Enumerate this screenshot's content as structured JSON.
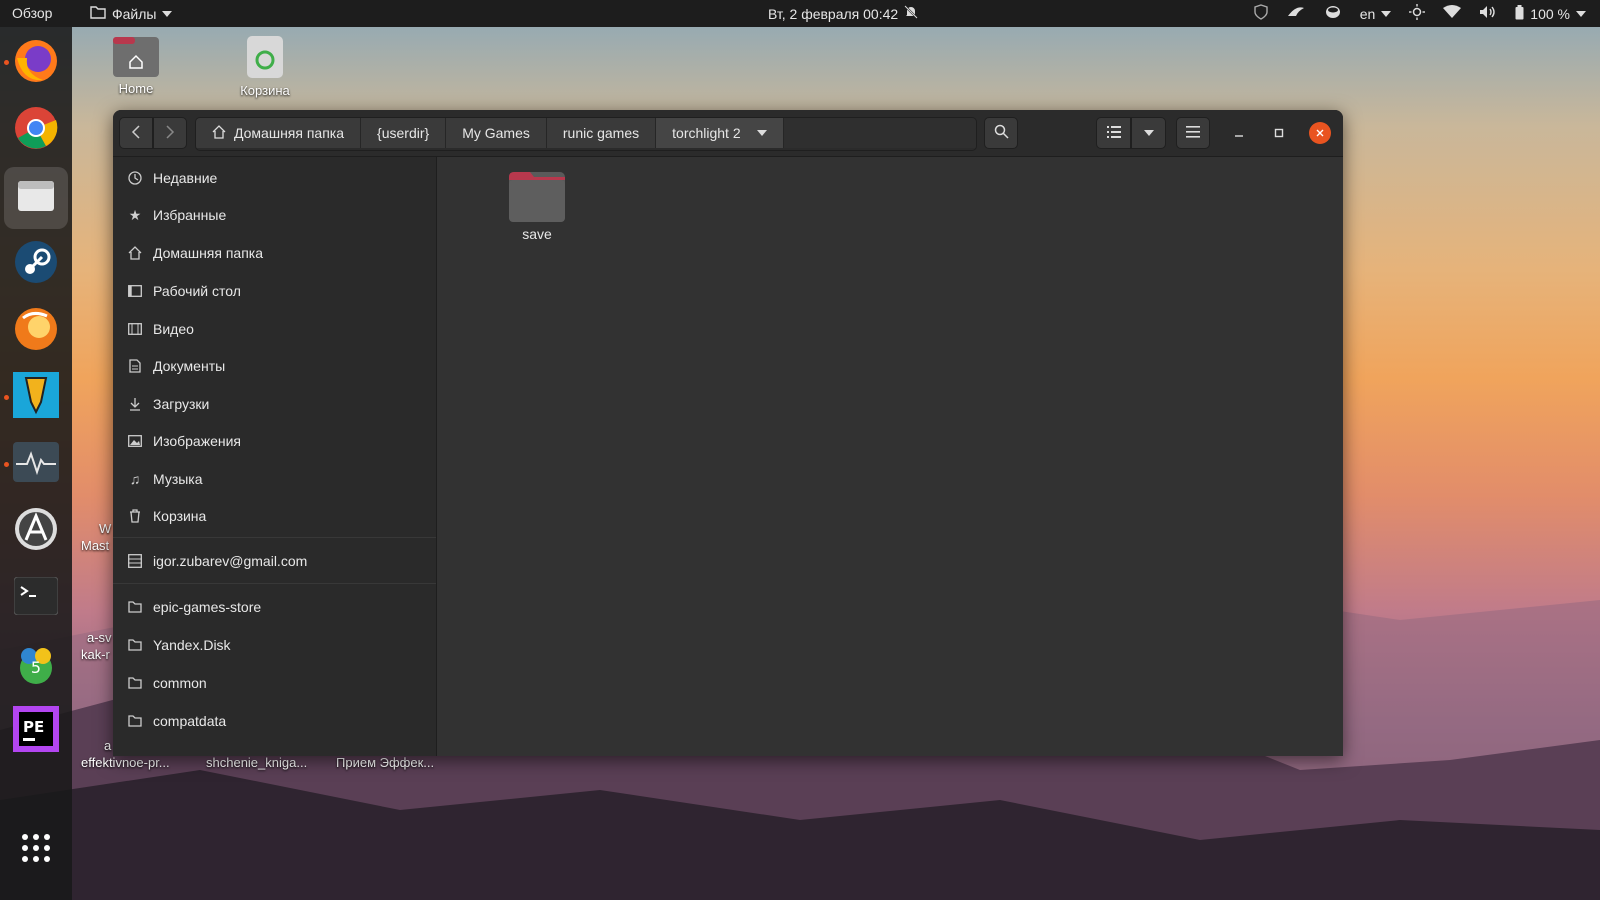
{
  "topbar": {
    "overview": "Обзор",
    "files_menu": "Файлы",
    "clock": "Вт, 2 февраля  00:42",
    "lang": "en",
    "battery": "100 %"
  },
  "desktop": {
    "home_label": "Home",
    "trash_label": "Корзина",
    "fragments": [
      "W",
      "Mast",
      "a-sv",
      "kak-r",
      "a",
      "effektivnoe-pr...",
      "shchenie_kniga...",
      "Прием Эффек..."
    ]
  },
  "dock": [
    "firefox-icon",
    "chrome-icon",
    "files-icon",
    "steam-icon",
    "ubuntu-software-icon",
    "game-launcher-icon",
    "system-monitor-icon",
    "app-store-icon",
    "terminal-icon",
    "metatrader-icon",
    "phpstorm-icon",
    "app-grid-icon"
  ],
  "pathbar": {
    "crumbs": [
      "Домашняя папка",
      "{userdir}",
      "My Games",
      "runic games",
      "torchlight 2"
    ]
  },
  "sidebar": {
    "places": [
      {
        "label": "Недавние",
        "icon": "clock-icon"
      },
      {
        "label": "Избранные",
        "icon": "star-icon"
      },
      {
        "label": "Домашняя папка",
        "icon": "home-icon"
      },
      {
        "label": "Рабочий стол",
        "icon": "desktop-icon"
      },
      {
        "label": "Видео",
        "icon": "video-icon"
      },
      {
        "label": "Документы",
        "icon": "document-icon"
      },
      {
        "label": "Загрузки",
        "icon": "download-icon"
      },
      {
        "label": "Изображения",
        "icon": "image-icon"
      },
      {
        "label": "Музыка",
        "icon": "music-icon"
      },
      {
        "label": "Корзина",
        "icon": "trash-icon"
      }
    ],
    "account": "igor.zubarev@gmail.com",
    "bookmarks": [
      "epic-games-store",
      "Yandex.Disk",
      "common",
      "compatdata"
    ]
  },
  "content": {
    "files": [
      {
        "name": "save",
        "type": "folder"
      }
    ]
  },
  "colors": {
    "accent": "#e95420",
    "folder_tab": "#b8384d",
    "folder_body": "#5a5a5a",
    "close_button": "#e95420"
  }
}
